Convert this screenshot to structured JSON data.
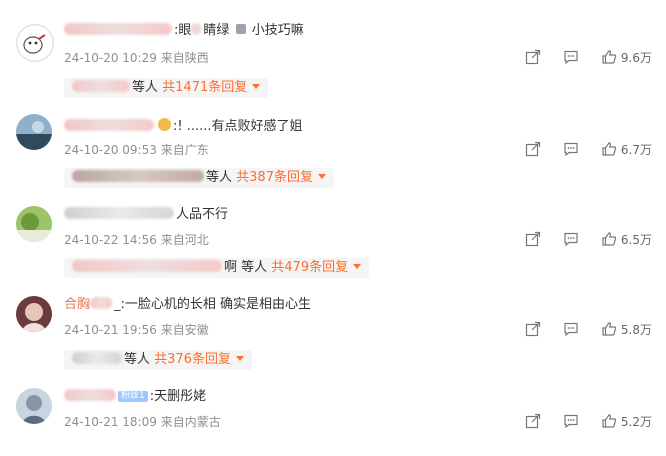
{
  "comments": [
    {
      "text_suffix": ":眼",
      "text_tail": "小技巧嘛",
      "text_mid": "睛绿",
      "date": "24-10-20 10:29",
      "location": "来自陕西",
      "reply_suffix": "等人",
      "reply_count": "共1471条回复",
      "likes": "9.6万"
    },
    {
      "text_suffix": ":!",
      "text_tail": "......有点败好感了姐",
      "date": "24-10-20 09:53",
      "location": "来自广东",
      "reply_suffix": "等人",
      "reply_count": "共387条回复",
      "likes": "6.7万"
    },
    {
      "text_suffix": "人品不行",
      "date": "24-10-22 14:56",
      "location": "来自河北",
      "reply_suffix": "啊 等人",
      "reply_count": "共479条回复",
      "likes": "6.5万"
    },
    {
      "name_visible": "合胸",
      "text_suffix": "_:一脸心机的长相 确实是相由心生",
      "date": "24-10-21 19:56",
      "location": "来自安徽",
      "reply_suffix": "等人",
      "reply_count": "共376条回复",
      "likes": "5.8万"
    },
    {
      "badge": "粉丝1",
      "text_suffix": ":天删彤姥",
      "date": "24-10-21 18:09",
      "location": "来自内蒙古",
      "likes": "5.2万"
    }
  ],
  "icons": {
    "share": "share-icon",
    "comment": "comment-icon",
    "like": "thumbs-up-icon",
    "caret": "caret-down-icon"
  },
  "colors": {
    "accent": "#ff6d2e",
    "meta": "#8f8f8f",
    "reply_bg": "#f5f5f5"
  }
}
